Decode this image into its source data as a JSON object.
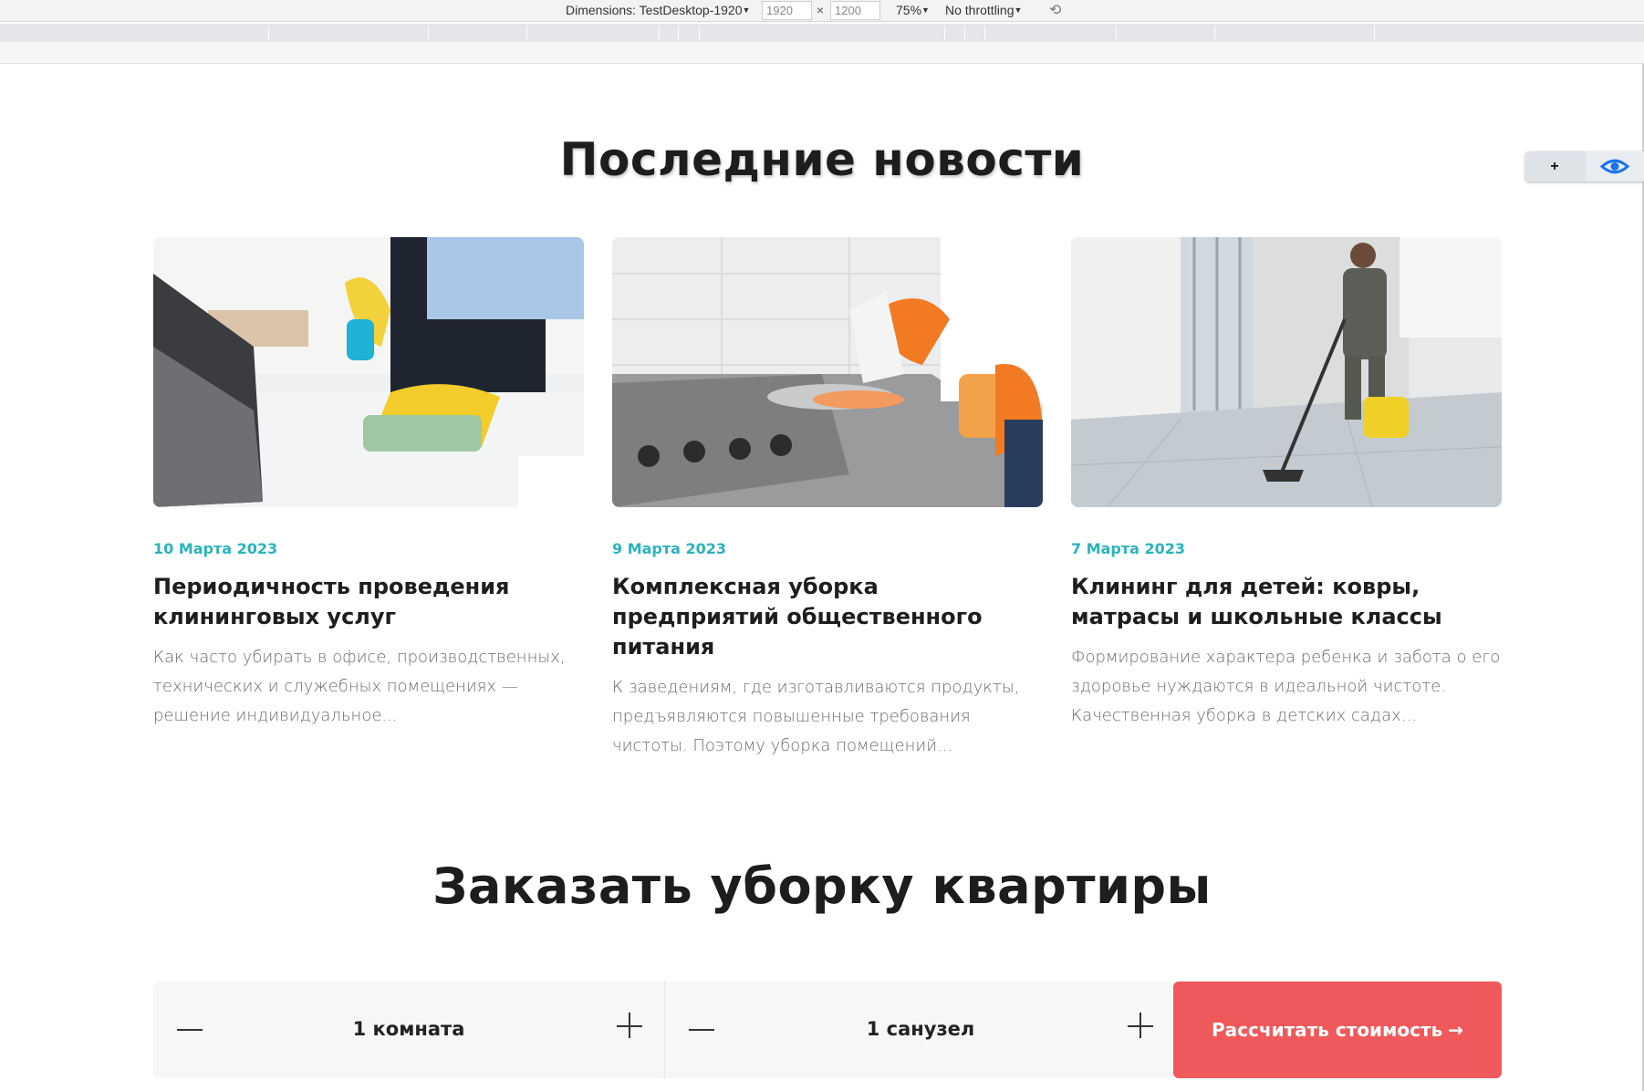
{
  "devtools": {
    "dimensions_label": "Dimensions: TestDesktop-1920",
    "width": "1920",
    "times": "×",
    "height": "1200",
    "zoom": "75%",
    "throttling": "No throttling"
  },
  "widget": {
    "add_label": "+"
  },
  "news": {
    "heading": "Последние новости",
    "cards": [
      {
        "date": "10 Марта 2023",
        "title": "Периодичность проведения клининговых услуг",
        "excerpt": "Как часто убирать в офисе, производственных, технических и служебных помещениях — решение индивидуальное..."
      },
      {
        "date": "9 Марта 2023",
        "title": "Комплексная уборка предприятий общественного питания",
        "excerpt": "К заведениям, где изготавливаются продукты, предъявляются повышенные требования чистоты. Поэтому уборка помещений..."
      },
      {
        "date": "7 Марта 2023",
        "title": "Клининг для детей: ковры, матрасы и школьные классы",
        "excerpt": "Формирование характера ребенка и забота о его здоровье нуждаются в идеальной чистоте. Качественная уборка в детских садах..."
      }
    ]
  },
  "order": {
    "heading": "Заказать уборку квартиры",
    "rooms_value": "1 комната",
    "bathrooms_value": "1 санузел",
    "calc_label": "Рассчитать стоимость",
    "calc_arrow": "→"
  },
  "colors": {
    "accent_teal": "#2bb3bd",
    "cta_red": "#f0595b"
  }
}
